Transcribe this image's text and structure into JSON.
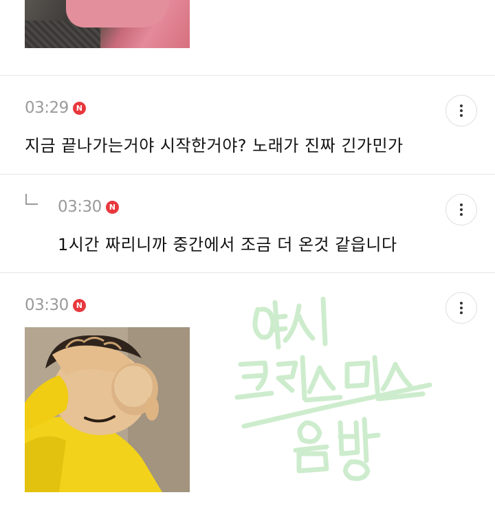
{
  "comments": [
    {
      "time": "03:29",
      "badge": "N",
      "text": "지금 끝나가는거야 시작한거야? 노래가 진짜 긴가민가"
    },
    {
      "time": "03:30",
      "badge": "N",
      "text": "1시간 짜리니까 중간에서 조금 더 온것 같읍니다",
      "is_reply": true
    },
    {
      "time": "03:30",
      "badge": "N",
      "text": ""
    }
  ],
  "watermark": {
    "lines": [
      "여시",
      "크리스마스",
      "음방"
    ],
    "color": "#cdeccd"
  },
  "icons": {
    "more": "more-vertical-icon",
    "reply": "reply-corner-icon",
    "new": "new-badge-icon"
  },
  "colors": {
    "badge": "#e8383d",
    "time": "#9a9a9a",
    "text": "#111111"
  }
}
